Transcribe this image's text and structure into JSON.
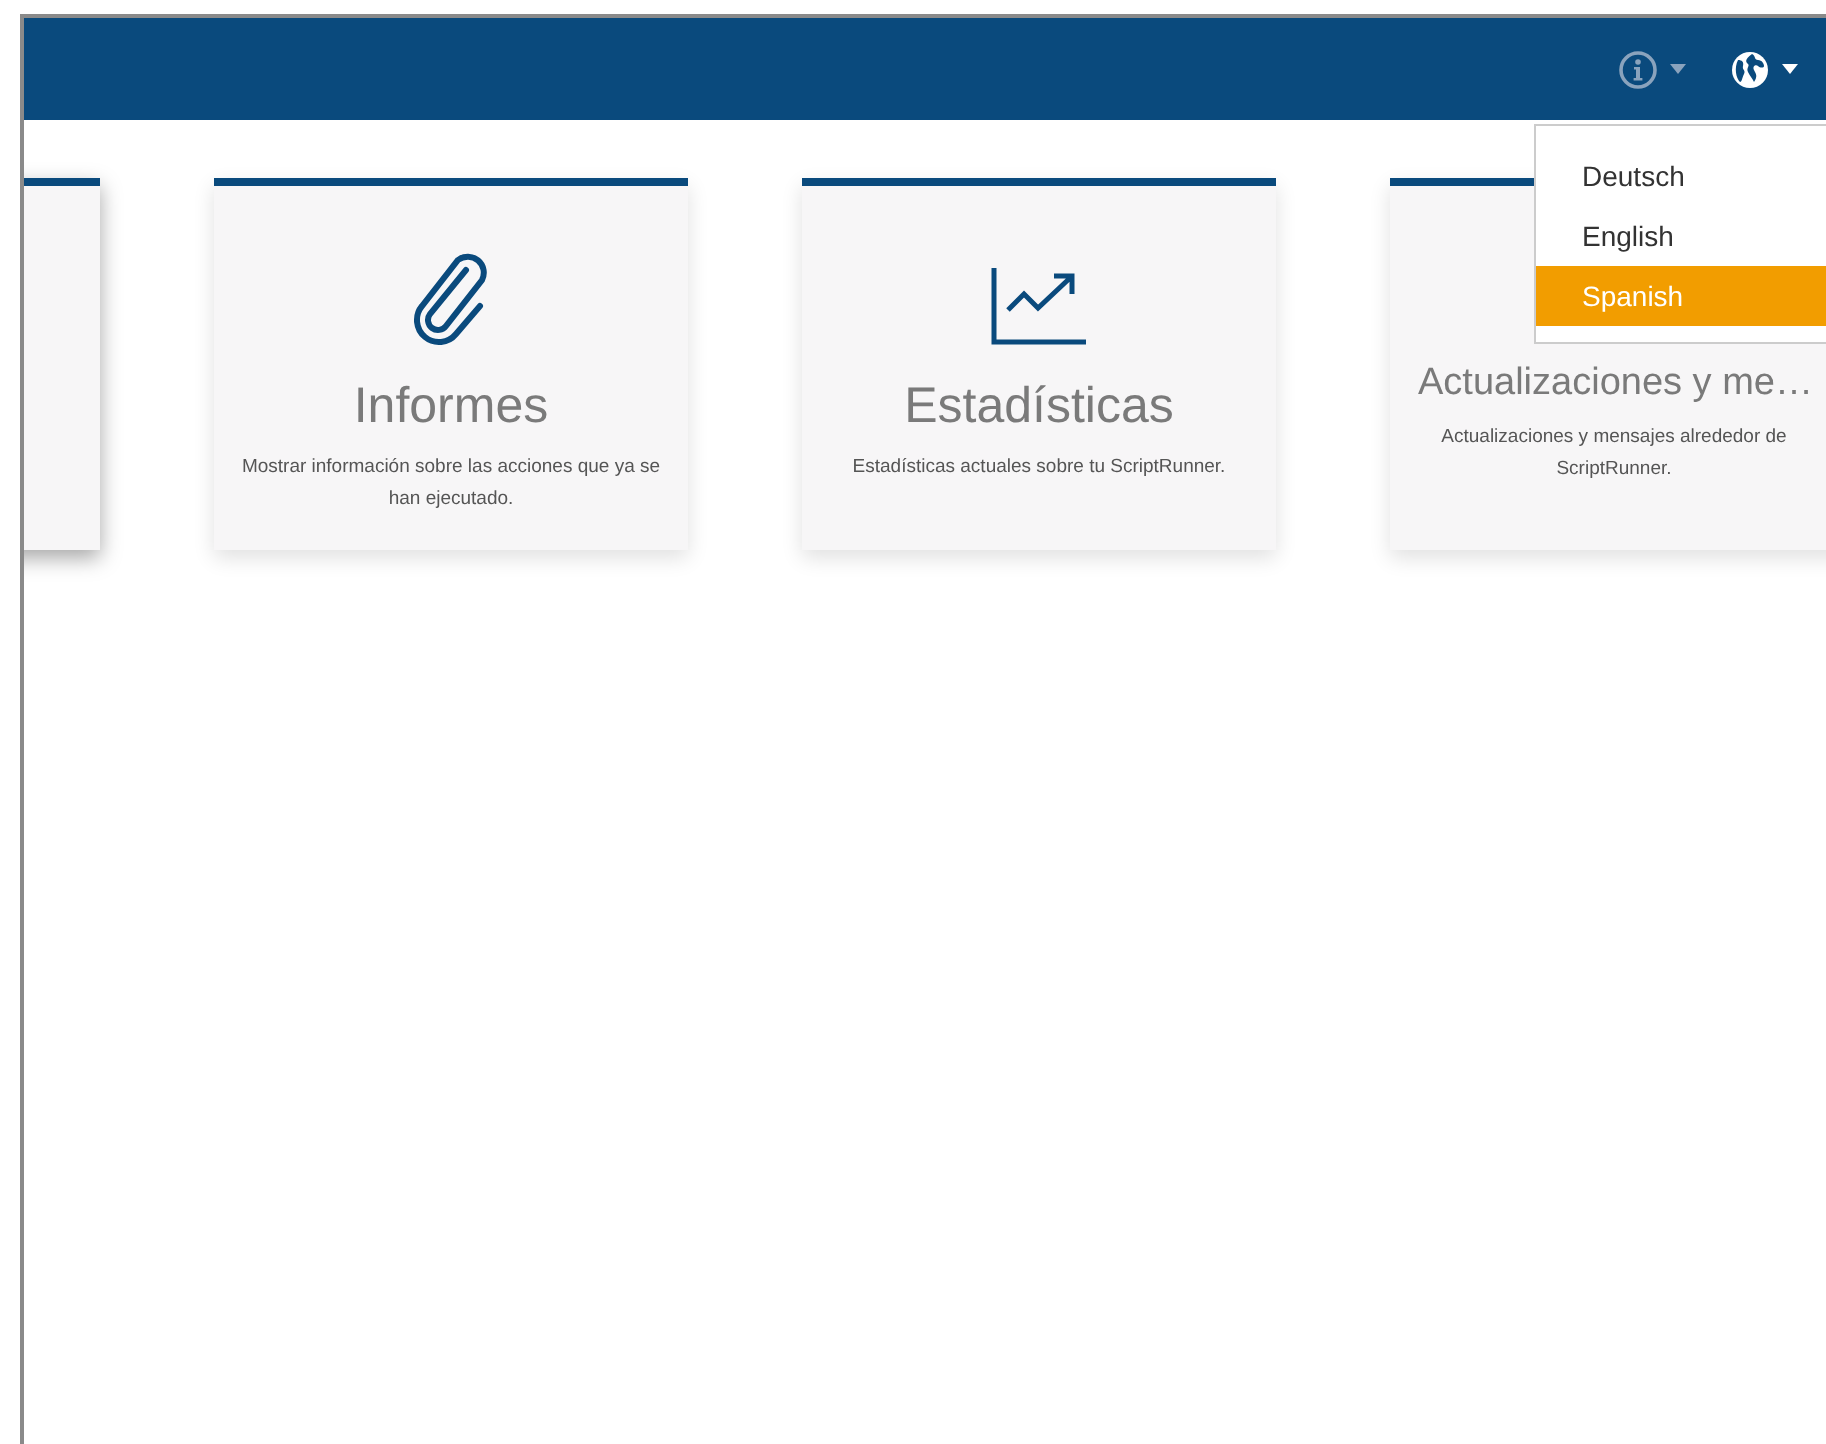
{
  "navbar": {
    "info_menu": {
      "disabled": true
    },
    "language_menu": {
      "items": [
        {
          "label": "Deutsch",
          "selected": false
        },
        {
          "label": "English",
          "selected": false
        },
        {
          "label": "Spanish",
          "selected": true
        }
      ]
    }
  },
  "cards": [
    {
      "title": "Informes",
      "description": "Mostrar información sobre las acciones que ya se han ejecutado."
    },
    {
      "title": "Estadísticas",
      "description": "Estadísticas actuales sobre tu ScriptRunner."
    },
    {
      "title": "Actualizaciones y me…",
      "description": "Actualizaciones y mensajes alrededor de ScriptRunner."
    }
  ]
}
